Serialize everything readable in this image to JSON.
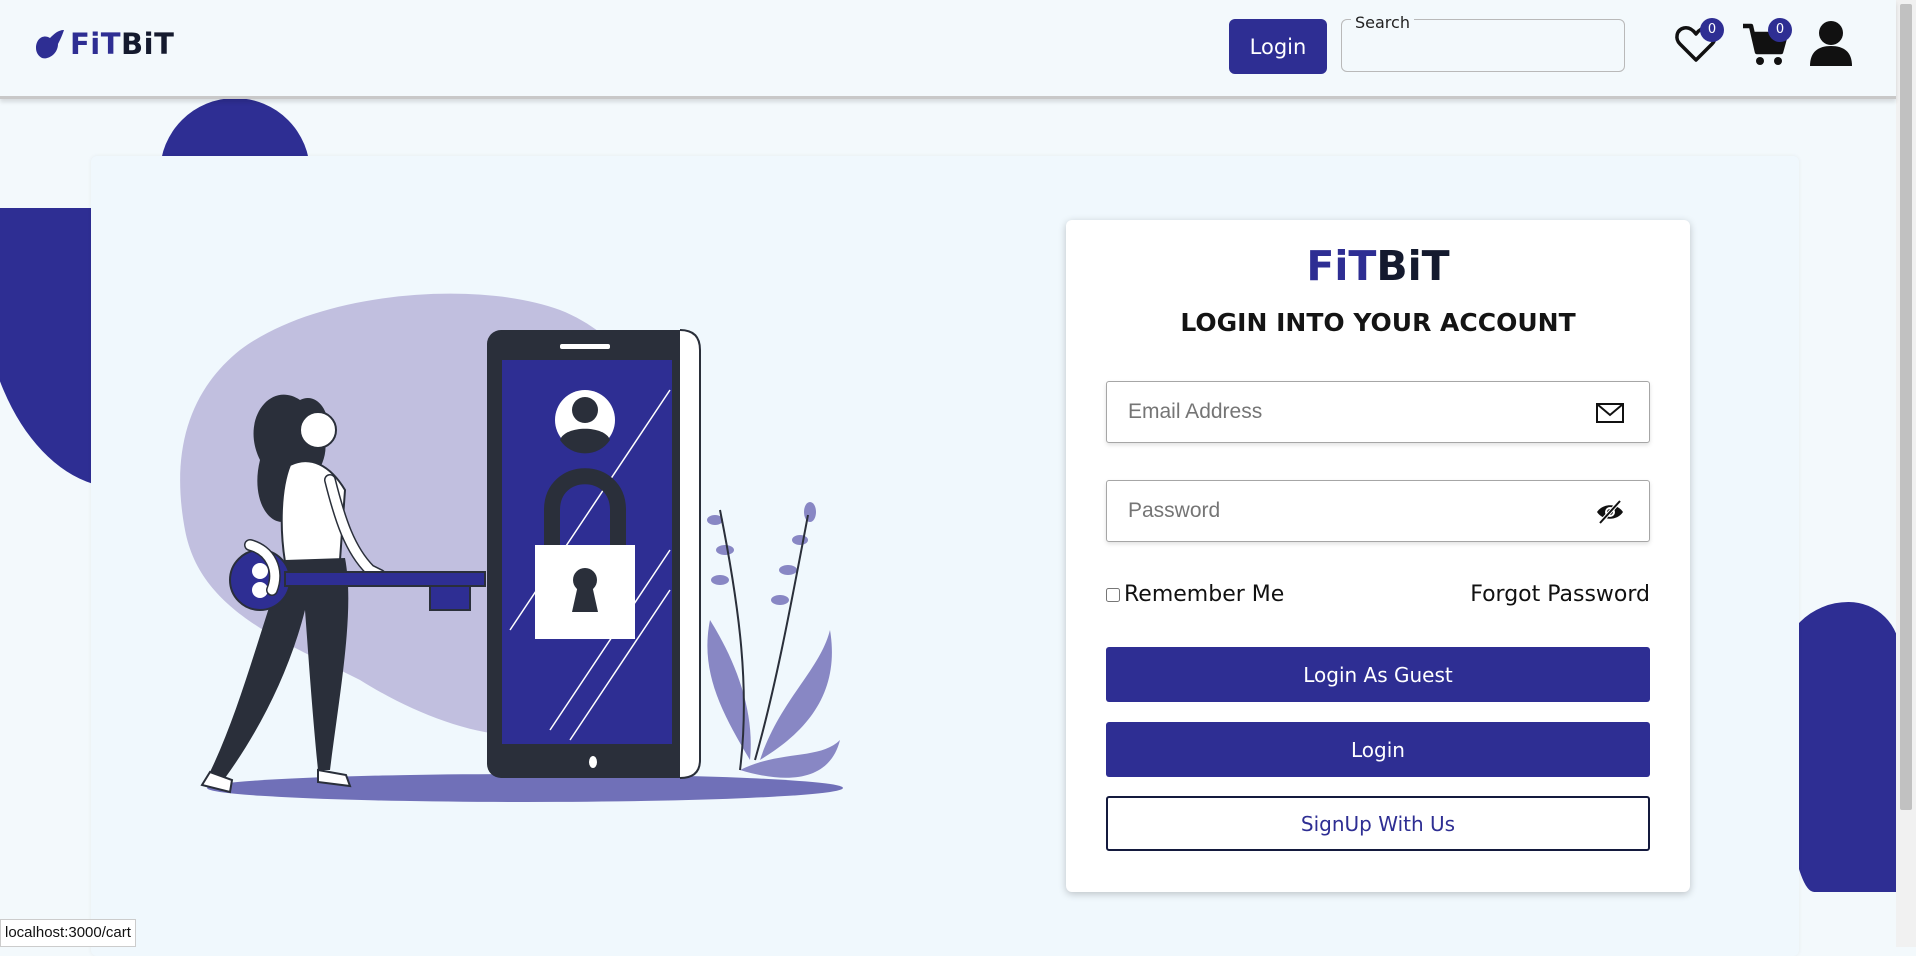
{
  "header": {
    "logo": {
      "part1": "FiT",
      "part2": "BiT"
    },
    "login_button": "Login",
    "search": {
      "label": "Search",
      "placeholder": ""
    },
    "wishlist_count": "0",
    "cart_count": "0"
  },
  "login_card": {
    "logo": {
      "part1": "FiT",
      "part2": "BiT"
    },
    "title": "LOGIN INTO YOUR ACCOUNT",
    "email_placeholder": "Email Address",
    "password_placeholder": "Password",
    "remember_label": "Remember Me",
    "forgot_label": "Forgot Password",
    "guest_button": "Login As Guest",
    "login_button": "Login",
    "signup_button": "SignUp With Us"
  },
  "status_bar": {
    "url": "localhost:3000/cart"
  },
  "colors": {
    "brand": "#2e2e93",
    "background": "#f3f9fc",
    "illustration_light": "#c1bfdf"
  },
  "icons": [
    "logo-icon",
    "heart-icon",
    "cart-icon",
    "user-icon",
    "mail-icon",
    "eye-off-icon"
  ]
}
